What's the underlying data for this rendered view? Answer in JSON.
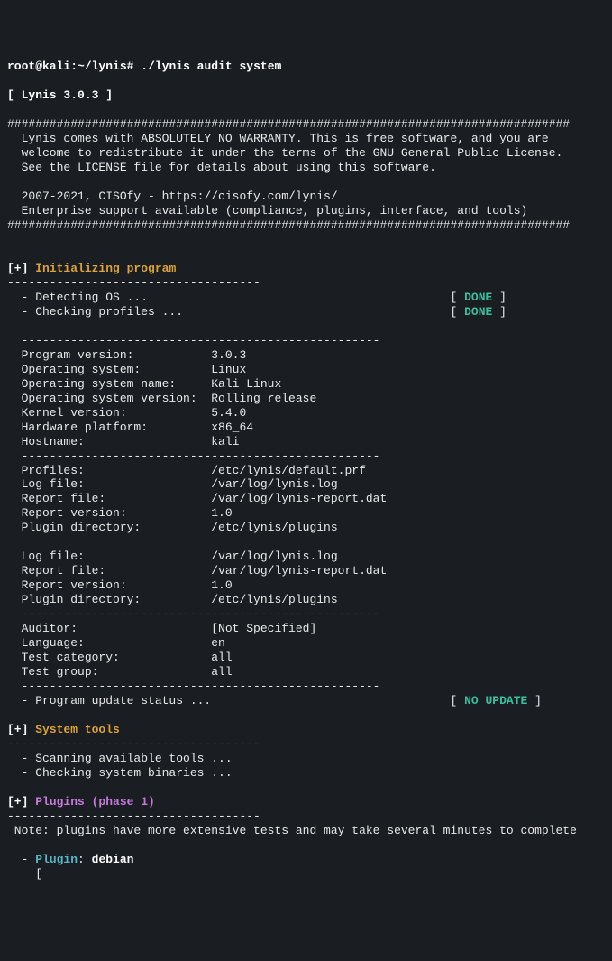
{
  "prompt": {
    "user": "root@kali",
    "path": "~/lynis",
    "symbol": "#",
    "command": "./lynis audit system"
  },
  "header": {
    "title": "[ Lynis 3.0.3 ]",
    "hashline": "################################################################################",
    "warranty1": "  Lynis comes with ABSOLUTELY NO WARRANTY. This is free software, and you are",
    "warranty2": "  welcome to redistribute it under the terms of the GNU General Public License.",
    "warranty3": "  See the LICENSE file for details about using this software.",
    "copyright": "  2007-2021, CISOfy - https://cisofy.com/lynis/",
    "enterprise": "  Enterprise support available (compliance, plugins, interface, and tools)"
  },
  "sections": {
    "init": {
      "prefix": "[+] ",
      "title": "Initializing program",
      "dashes": "------------------------------------",
      "detecting_os": "  - Detecting OS ...                                           [ ",
      "detecting_os_status": "DONE",
      "detecting_os_close": " ]",
      "checking_profiles": "  - Checking profiles ...                                      [ ",
      "checking_profiles_status": "DONE",
      "checking_profiles_close": " ]",
      "divider": "  ---------------------------------------------------",
      "program_version": "  Program version:           3.0.3",
      "os": "  Operating system:          Linux",
      "os_name": "  Operating system name:     Kali Linux",
      "os_version": "  Operating system version:  Rolling release",
      "kernel": "  Kernel version:            5.4.0",
      "hardware": "  Hardware platform:         x86_64",
      "hostname": "  Hostname:                  kali",
      "profiles": "  Profiles:                  /etc/lynis/default.prf",
      "logfile": "  Log file:                  /var/log/lynis.log",
      "reportfile": "  Report file:               /var/log/lynis-report.dat",
      "reportversion": "  Report version:            1.0",
      "plugindir": "  Plugin directory:          /etc/lynis/plugins",
      "logfile2": "  Log file:                  /var/log/lynis.log",
      "reportfile2": "  Report file:               /var/log/lynis-report.dat",
      "reportversion2": "  Report version:            1.0",
      "plugindir2": "  Plugin directory:          /etc/lynis/plugins",
      "auditor": "  Auditor:                   [Not Specified]",
      "language": "  Language:                  en",
      "testcat": "  Test category:             all",
      "testgroup": "  Test group:                all",
      "update": "  - Program update status ...                                  [ ",
      "update_status": "NO UPDATE",
      "update_close": " ]"
    },
    "tools": {
      "prefix": "[+] ",
      "title": "System tools",
      "dashes": "------------------------------------",
      "scanning": "  - Scanning available tools ...",
      "checking": "  - Checking system binaries ..."
    },
    "plugins": {
      "prefix": "[+] ",
      "title": "Plugins (phase 1)",
      "dashes": "------------------------------------",
      "note": " Note: plugins have more extensive tests and may take several minutes to complete",
      "plugin_prefix": "  - ",
      "plugin_label": "Plugin",
      "plugin_sep": ": ",
      "plugin_name": "debian",
      "bracket": "    ["
    }
  }
}
